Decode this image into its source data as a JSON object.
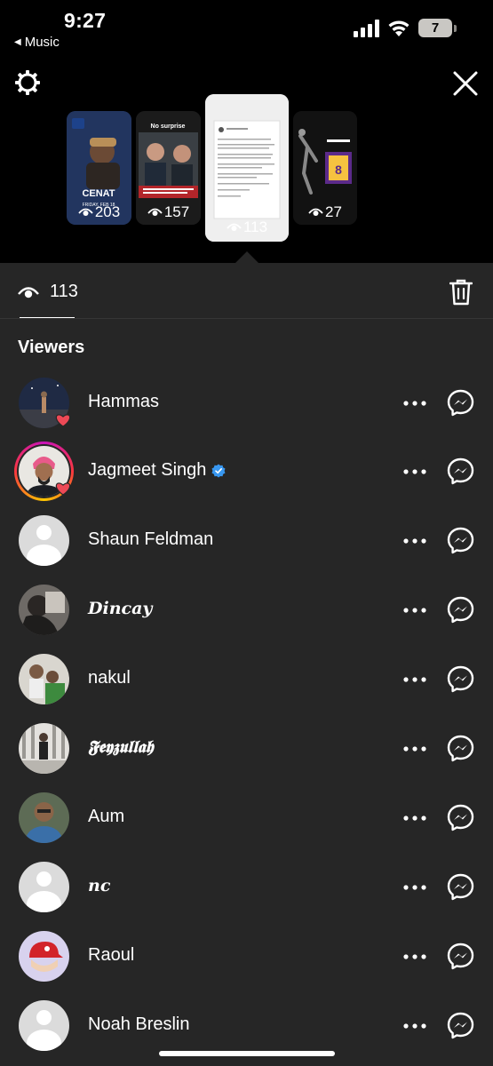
{
  "status_bar": {
    "time": "9:27",
    "back_app": "Music",
    "battery": "7"
  },
  "stories": [
    {
      "views": "203",
      "caption": "CENAT"
    },
    {
      "views": "157",
      "caption": "No surprise"
    },
    {
      "views": "113"
    },
    {
      "views": "27"
    }
  ],
  "tab": {
    "view_count": "113"
  },
  "viewers_title": "Viewers",
  "viewers": [
    {
      "name": "Hammas",
      "liked": true,
      "has_photo": true
    },
    {
      "name": "Jagmeet Singh",
      "verified": true,
      "liked": true,
      "has_story_ring": true
    },
    {
      "name": "Shaun Feldman",
      "default_avatar": true
    },
    {
      "name": "𝑫𝒊𝒏𝒄𝒂𝒚",
      "has_photo": true
    },
    {
      "name": "nakul",
      "has_photo": true
    },
    {
      "name": "𝕱𝖊𝖞𝖟𝖚𝖑𝖑𝖆𝖍",
      "has_photo": true
    },
    {
      "name": "Aum",
      "has_photo": true
    },
    {
      "name": "𝒏𝒄",
      "default_avatar": true
    },
    {
      "name": "Raoul",
      "has_photo": true
    },
    {
      "name": "Noah Breslin",
      "default_avatar": true
    }
  ],
  "colors": {
    "panel_bg": "#262626",
    "like_red": "#ed4956",
    "verified_blue": "#3897f0"
  }
}
